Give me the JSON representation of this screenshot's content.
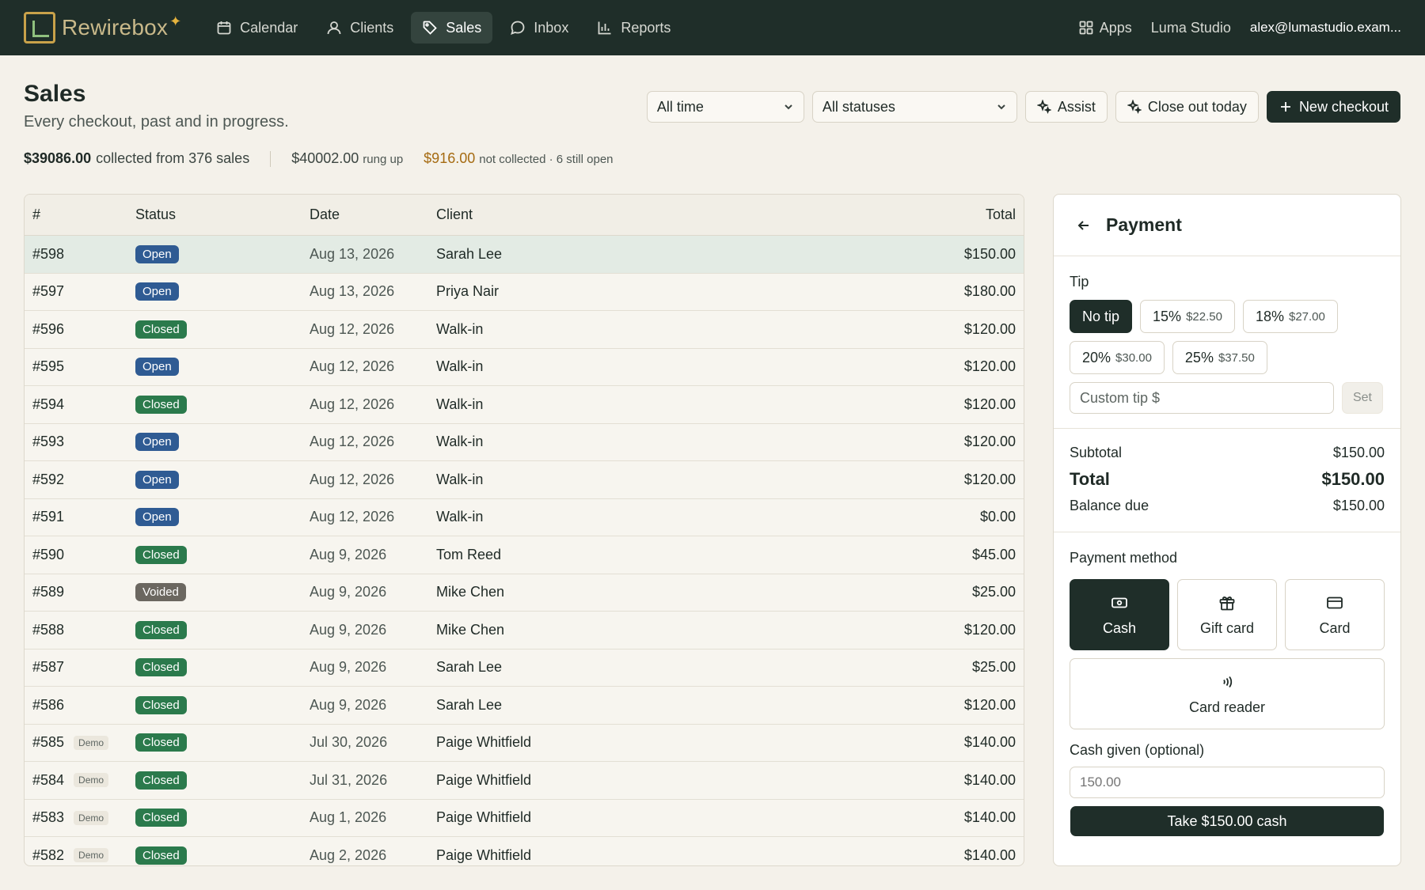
{
  "brand": {
    "name": "Rewirebox"
  },
  "nav": {
    "items": [
      {
        "label": "Calendar",
        "icon": "calendar-icon",
        "active": false
      },
      {
        "label": "Clients",
        "icon": "user-icon",
        "active": false
      },
      {
        "label": "Sales",
        "icon": "tag-icon",
        "active": true
      },
      {
        "label": "Inbox",
        "icon": "chat-bubble-icon",
        "active": false
      },
      {
        "label": "Reports",
        "icon": "bar-chart-icon",
        "active": false
      }
    ],
    "apps_label": "Apps",
    "studio": "Luma Studio",
    "email": "alex@lumastudio.exam..."
  },
  "header": {
    "title": "Sales",
    "subtitle": "Every checkout, past and in progress.",
    "filters": {
      "time": "All time",
      "status": "All statuses"
    },
    "assist_label": "Assist",
    "close_out_label": "Close out today",
    "new_checkout_label": "New checkout"
  },
  "stats": {
    "collected": "$39086.00",
    "collected_text": "collected from 376 sales",
    "rung_up": "$40002.00",
    "rung_up_text": "rung up",
    "not_collected": "$916.00",
    "not_collected_text": "not collected · 6 still open"
  },
  "table": {
    "columns": {
      "num": "#",
      "status": "Status",
      "date": "Date",
      "client": "Client",
      "total": "Total"
    },
    "rows": [
      {
        "num": "#598",
        "demo": "",
        "status": "Open",
        "kind": "open",
        "date": "Aug 13, 2026",
        "client": "Sarah Lee",
        "total": "$150.00",
        "selected": true
      },
      {
        "num": "#597",
        "demo": "",
        "status": "Open",
        "kind": "open",
        "date": "Aug 13, 2026",
        "client": "Priya Nair",
        "total": "$180.00"
      },
      {
        "num": "#596",
        "demo": "",
        "status": "Closed",
        "kind": "closed",
        "date": "Aug 12, 2026",
        "client": "Walk-in",
        "total": "$120.00"
      },
      {
        "num": "#595",
        "demo": "",
        "status": "Open",
        "kind": "open",
        "date": "Aug 12, 2026",
        "client": "Walk-in",
        "total": "$120.00"
      },
      {
        "num": "#594",
        "demo": "",
        "status": "Closed",
        "kind": "closed",
        "date": "Aug 12, 2026",
        "client": "Walk-in",
        "total": "$120.00"
      },
      {
        "num": "#593",
        "demo": "",
        "status": "Open",
        "kind": "open",
        "date": "Aug 12, 2026",
        "client": "Walk-in",
        "total": "$120.00"
      },
      {
        "num": "#592",
        "demo": "",
        "status": "Open",
        "kind": "open",
        "date": "Aug 12, 2026",
        "client": "Walk-in",
        "total": "$120.00"
      },
      {
        "num": "#591",
        "demo": "",
        "status": "Open",
        "kind": "open",
        "date": "Aug 12, 2026",
        "client": "Walk-in",
        "total": "$0.00"
      },
      {
        "num": "#590",
        "demo": "",
        "status": "Closed",
        "kind": "closed",
        "date": "Aug 9, 2026",
        "client": "Tom Reed",
        "total": "$45.00"
      },
      {
        "num": "#589",
        "demo": "",
        "status": "Voided",
        "kind": "voided",
        "date": "Aug 9, 2026",
        "client": "Mike Chen",
        "total": "$25.00"
      },
      {
        "num": "#588",
        "demo": "",
        "status": "Closed",
        "kind": "closed",
        "date": "Aug 9, 2026",
        "client": "Mike Chen",
        "total": "$120.00"
      },
      {
        "num": "#587",
        "demo": "",
        "status": "Closed",
        "kind": "closed",
        "date": "Aug 9, 2026",
        "client": "Sarah Lee",
        "total": "$25.00"
      },
      {
        "num": "#586",
        "demo": "",
        "status": "Closed",
        "kind": "closed",
        "date": "Aug 9, 2026",
        "client": "Sarah Lee",
        "total": "$120.00"
      },
      {
        "num": "#585",
        "demo": "Demo",
        "status": "Closed",
        "kind": "closed",
        "date": "Jul 30, 2026",
        "client": "Paige Whitfield",
        "total": "$140.00"
      },
      {
        "num": "#584",
        "demo": "Demo",
        "status": "Closed",
        "kind": "closed",
        "date": "Jul 31, 2026",
        "client": "Paige Whitfield",
        "total": "$140.00"
      },
      {
        "num": "#583",
        "demo": "Demo",
        "status": "Closed",
        "kind": "closed",
        "date": "Aug 1, 2026",
        "client": "Paige Whitfield",
        "total": "$140.00"
      },
      {
        "num": "#582",
        "demo": "Demo",
        "status": "Closed",
        "kind": "closed",
        "date": "Aug 2, 2026",
        "client": "Paige Whitfield",
        "total": "$140.00"
      }
    ]
  },
  "payment": {
    "title": "Payment",
    "tip_label": "Tip",
    "tips": [
      {
        "label": "No tip",
        "amount": "",
        "active": true
      },
      {
        "label": "15%",
        "amount": "$22.50",
        "active": false
      },
      {
        "label": "18%",
        "amount": "$27.00",
        "active": false
      },
      {
        "label": "20%",
        "amount": "$30.00",
        "active": false
      },
      {
        "label": "25%",
        "amount": "$37.50",
        "active": false
      }
    ],
    "custom_tip_placeholder": "Custom tip $",
    "set_label": "Set",
    "subtotal_label": "Subtotal",
    "subtotal": "$150.00",
    "total_label": "Total",
    "total": "$150.00",
    "balance_label": "Balance due",
    "balance": "$150.00",
    "method_label": "Payment method",
    "methods": [
      {
        "label": "Cash",
        "icon": "cash-icon",
        "active": true
      },
      {
        "label": "Gift card",
        "icon": "gift-icon",
        "active": false
      },
      {
        "label": "Card",
        "icon": "credit-card-icon",
        "active": false
      },
      {
        "label": "Card reader",
        "icon": "contactless-icon",
        "active": false
      }
    ],
    "cash_given_label": "Cash given (optional)",
    "cash_given_placeholder": "150.00",
    "take_label": "Take $150.00 cash"
  },
  "colors": {
    "nav_bg": "#1f2e29",
    "page_bg": "#f4f1ea",
    "open_badge": "#2f5b93",
    "closed_badge": "#2b7a4c",
    "voided_badge": "#6b6760",
    "warning_text": "#a56b12",
    "selected_row": "#e3ebe4"
  }
}
